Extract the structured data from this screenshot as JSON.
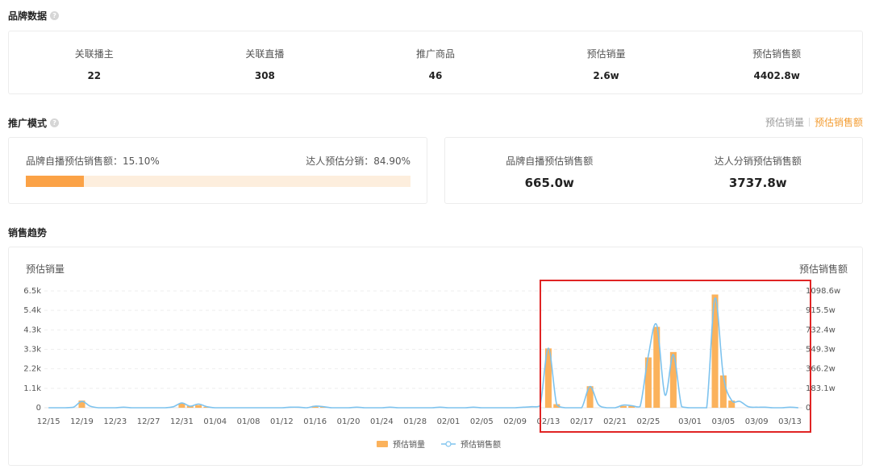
{
  "brand": {
    "title": "品牌数据",
    "stats": [
      {
        "label": "关联播主",
        "value": "22"
      },
      {
        "label": "关联直播",
        "value": "308"
      },
      {
        "label": "推广商品",
        "value": "46"
      },
      {
        "label": "预估销量",
        "value": "2.6w"
      },
      {
        "label": "预估销售额",
        "value": "4402.8w"
      }
    ]
  },
  "promo": {
    "title": "推广模式",
    "toggle": {
      "sales_volume": "预估销量",
      "sales_amount": "预估销售额",
      "active": "sales_amount"
    },
    "self_share_label": "品牌自播预估销售额：15.10%",
    "talent_share_label": "达人预估分销：84.90%",
    "self_share": 0.151,
    "amounts": [
      {
        "label": "品牌自播预估销售额",
        "value": "665.0w"
      },
      {
        "label": "达人分销预估销售额",
        "value": "3737.8w"
      }
    ]
  },
  "trend": {
    "title": "销售趋势"
  },
  "colors": {
    "accent": "#f39c31",
    "bar": "#fbb25c",
    "line": "#7ec3ee",
    "highlight": "#e02424"
  },
  "chart_data": {
    "type": "bar",
    "ylabel_left": "预估销量",
    "ylabel_right": "预估销售额",
    "left_ticks": [
      "0",
      "1.1k",
      "2.2k",
      "3.3k",
      "4.3k",
      "5.4k",
      "6.5k"
    ],
    "right_ticks": [
      "0",
      "183.1w",
      "366.2w",
      "549.3w",
      "732.4w",
      "915.5w",
      "1098.6w"
    ],
    "ylim_left": [
      0,
      6500
    ],
    "ylim_right": [
      0,
      1098.6
    ],
    "x_tick_labels": [
      "12/15",
      "12/19",
      "12/23",
      "12/27",
      "12/31",
      "01/04",
      "01/08",
      "01/12",
      "01/16",
      "01/20",
      "01/24",
      "01/28",
      "02/01",
      "02/05",
      "02/09",
      "02/13",
      "02/17",
      "02/21",
      "02/25",
      "03/01",
      "03/05",
      "03/09",
      "03/13"
    ],
    "x": [
      "12/15",
      "12/16",
      "12/17",
      "12/18",
      "12/19",
      "12/20",
      "12/21",
      "12/22",
      "12/23",
      "12/24",
      "12/25",
      "12/26",
      "12/27",
      "12/28",
      "12/29",
      "12/30",
      "12/31",
      "01/01",
      "01/02",
      "01/03",
      "01/04",
      "01/05",
      "01/06",
      "01/07",
      "01/08",
      "01/09",
      "01/10",
      "01/11",
      "01/12",
      "01/13",
      "01/14",
      "01/15",
      "01/16",
      "01/17",
      "01/18",
      "01/19",
      "01/20",
      "01/21",
      "01/22",
      "01/23",
      "01/24",
      "01/25",
      "01/26",
      "01/27",
      "01/28",
      "01/29",
      "01/30",
      "01/31",
      "02/01",
      "02/02",
      "02/03",
      "02/04",
      "02/05",
      "02/06",
      "02/07",
      "02/08",
      "02/09",
      "02/10",
      "02/11",
      "02/12",
      "02/13",
      "02/14",
      "02/15",
      "02/16",
      "02/17",
      "02/18",
      "02/19",
      "02/20",
      "02/21",
      "02/22",
      "02/23",
      "02/24",
      "02/25",
      "02/26",
      "02/27",
      "02/28",
      "02/29",
      "03/01",
      "03/02",
      "03/03",
      "03/04",
      "03/05",
      "03/06",
      "03/07",
      "03/08",
      "03/09",
      "03/10",
      "03/11",
      "03/12",
      "03/13",
      "03/14"
    ],
    "series": [
      {
        "name": "预估销量",
        "type": "bar",
        "values": [
          0,
          0,
          0,
          0,
          400,
          0,
          0,
          0,
          0,
          0,
          0,
          0,
          0,
          0,
          0,
          0,
          250,
          100,
          150,
          50,
          0,
          0,
          0,
          0,
          0,
          0,
          0,
          0,
          0,
          0,
          0,
          0,
          100,
          50,
          0,
          0,
          0,
          0,
          0,
          0,
          0,
          0,
          0,
          0,
          0,
          0,
          0,
          0,
          0,
          0,
          0,
          0,
          0,
          0,
          0,
          0,
          0,
          0,
          0,
          0,
          3300,
          200,
          0,
          0,
          0,
          1200,
          0,
          0,
          0,
          100,
          100,
          0,
          2800,
          4500,
          0,
          3100,
          0,
          0,
          0,
          0,
          6300,
          1800,
          400,
          0,
          0,
          0,
          0,
          0,
          0,
          0,
          0
        ]
      },
      {
        "name": "预估销售额",
        "type": "line",
        "values": [
          0,
          0,
          0,
          5,
          60,
          15,
          0,
          0,
          0,
          5,
          0,
          0,
          0,
          0,
          0,
          10,
          45,
          15,
          35,
          10,
          0,
          0,
          0,
          0,
          0,
          0,
          0,
          0,
          0,
          5,
          5,
          0,
          15,
          10,
          0,
          0,
          0,
          5,
          0,
          0,
          0,
          5,
          0,
          0,
          0,
          0,
          0,
          5,
          0,
          0,
          0,
          5,
          0,
          0,
          0,
          0,
          0,
          5,
          10,
          20,
          560,
          30,
          0,
          0,
          0,
          200,
          30,
          0,
          0,
          25,
          20,
          10,
          490,
          780,
          120,
          500,
          10,
          0,
          0,
          0,
          1030,
          300,
          70,
          60,
          10,
          5,
          5,
          0,
          0,
          5,
          0
        ]
      }
    ],
    "grid": true,
    "legend": "bottom"
  }
}
